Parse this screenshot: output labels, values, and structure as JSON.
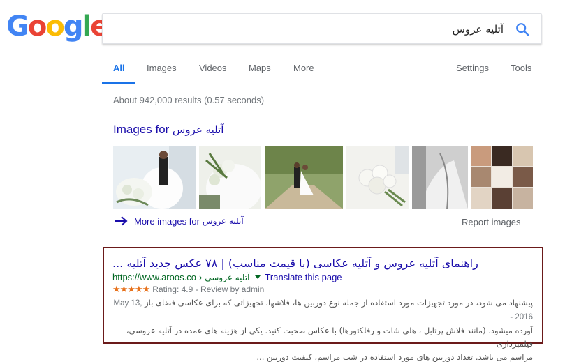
{
  "logo": {
    "letters": [
      "G",
      "o",
      "o",
      "g",
      "l",
      "e"
    ],
    "colors": [
      "#4285F4",
      "#EA4335",
      "#FBBC05",
      "#4285F4",
      "#34A853",
      "#EA4335"
    ]
  },
  "search": {
    "query": "آتلیه عروس",
    "icon": "search-icon"
  },
  "nav": {
    "tabs": [
      "All",
      "Images",
      "Videos",
      "Maps",
      "More"
    ],
    "right": [
      "Settings",
      "Tools"
    ]
  },
  "stats": "About 942,000 results (0.57 seconds)",
  "images": {
    "heading_prefix": "Images for",
    "heading_query": "آتلیه عروس",
    "more_prefix": "More images for",
    "more_query": "آتلیه عروس",
    "report": "Report images",
    "arrow_icon": "arrow-right-icon"
  },
  "result": {
    "title": "راهنمای آتلیه عروس و آتلیه عکاسی (با قیمت مناسب) | ۷۸ عکس جدید آتلیه ...",
    "url": "https://www.aroos.co",
    "separator": "›",
    "breadcrumb": "آتلیه عروسی",
    "translate": "Translate this page",
    "stars": "★★★★★",
    "rating": "Rating: 4.9 - Review by admin",
    "date": "May 13, 2016 -",
    "snippet_line1": "پیشنهاد می شود، در مورد تجهیزات مورد استفاده از جمله نوع دوربین ها، فلاشها، تجهیزاتی که برای عکاسی فضای باز",
    "snippet_line2": "آورده میشود، (مانند فلاش پرتابل ، هلی شات و رفلکتورها) با عکاس صحبت کنید. یکی از هزینه های عمده در آتلیه عروسی، فیلمبرداری",
    "snippet_line3": "مراسم می باشد. تعداد دوربین های مورد استفاده در شب مراسم، کیفیت دوربین ..."
  }
}
